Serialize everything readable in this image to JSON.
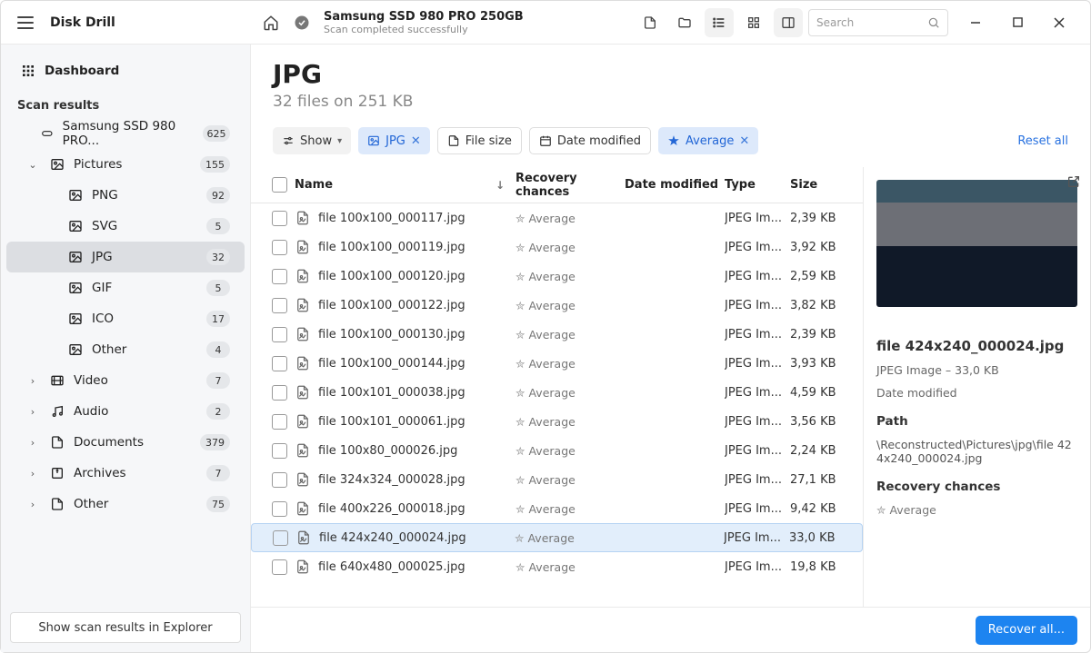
{
  "app_title": "Disk Drill",
  "scan": {
    "title": "Samsung SSD 980 PRO 250GB",
    "status": "Scan completed successfully"
  },
  "search": {
    "placeholder": "Search"
  },
  "sidebar": {
    "dashboard": "Dashboard",
    "section": "Scan results",
    "drive": {
      "label": "Samsung SSD 980 PRO...",
      "count": "625"
    },
    "tree": [
      {
        "label": "Pictures",
        "count": "155",
        "chev": "v",
        "children": [
          {
            "label": "PNG",
            "count": "92"
          },
          {
            "label": "SVG",
            "count": "5"
          },
          {
            "label": "JPG",
            "count": "32",
            "selected": true
          },
          {
            "label": "GIF",
            "count": "5"
          },
          {
            "label": "ICO",
            "count": "17"
          },
          {
            "label": "Other",
            "count": "4"
          }
        ]
      },
      {
        "label": "Video",
        "count": "7",
        "chev": ">"
      },
      {
        "label": "Audio",
        "count": "2",
        "chev": ">"
      },
      {
        "label": "Documents",
        "count": "379",
        "chev": ">"
      },
      {
        "label": "Archives",
        "count": "7",
        "chev": ">"
      },
      {
        "label": "Other",
        "count": "75",
        "chev": ">"
      }
    ],
    "explorer_btn": "Show scan results in Explorer"
  },
  "page": {
    "title": "JPG",
    "subtitle": "32 files on 251 KB"
  },
  "filters": {
    "show": "Show",
    "jpg": "JPG",
    "size": "File size",
    "modified": "Date modified",
    "average": "Average",
    "reset": "Reset all"
  },
  "columns": {
    "name": "Name",
    "recovery": "Recovery chances",
    "modified": "Date modified",
    "type": "Type",
    "size": "Size"
  },
  "recovery_label": "Average",
  "type_label": "JPEG Im...",
  "rows": [
    {
      "name": "file 100x100_000117.jpg",
      "size": "2,39 KB"
    },
    {
      "name": "file 100x100_000119.jpg",
      "size": "3,92 KB"
    },
    {
      "name": "file 100x100_000120.jpg",
      "size": "2,59 KB"
    },
    {
      "name": "file 100x100_000122.jpg",
      "size": "3,82 KB"
    },
    {
      "name": "file 100x100_000130.jpg",
      "size": "2,39 KB"
    },
    {
      "name": "file 100x100_000144.jpg",
      "size": "3,93 KB"
    },
    {
      "name": "file 100x101_000038.jpg",
      "size": "4,59 KB"
    },
    {
      "name": "file 100x101_000061.jpg",
      "size": "3,56 KB"
    },
    {
      "name": "file 100x80_000026.jpg",
      "size": "2,24 KB"
    },
    {
      "name": "file 324x324_000028.jpg",
      "size": "27,1 KB"
    },
    {
      "name": "file 400x226_000018.jpg",
      "size": "9,42 KB"
    },
    {
      "name": "file 424x240_000024.jpg",
      "size": "33,0 KB",
      "selected": true
    },
    {
      "name": "file 640x480_000025.jpg",
      "size": "19,8 KB"
    }
  ],
  "details": {
    "title": "file 424x240_000024.jpg",
    "meta": "JPEG Image – 33,0 KB",
    "modified": "Date modified",
    "path_label": "Path",
    "path": "\\Reconstructed\\Pictures\\jpg\\file 424x240_000024.jpg",
    "rec_label": "Recovery chances",
    "rec_value": "Average"
  },
  "footer": {
    "recover": "Recover all..."
  }
}
